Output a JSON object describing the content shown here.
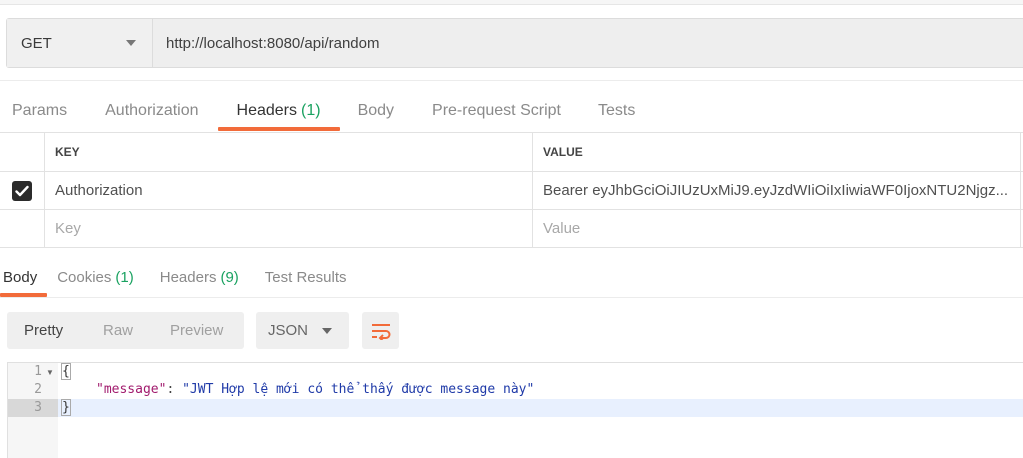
{
  "request": {
    "method": "GET",
    "url": "http://localhost:8080/api/random"
  },
  "request_tabs": [
    {
      "label": "Params",
      "count": ""
    },
    {
      "label": "Authorization",
      "count": ""
    },
    {
      "label": "Headers",
      "count": "(1)",
      "active": true
    },
    {
      "label": "Body",
      "count": ""
    },
    {
      "label": "Pre-request Script",
      "count": ""
    },
    {
      "label": "Tests",
      "count": ""
    }
  ],
  "headers_table": {
    "columns": [
      "KEY",
      "VALUE"
    ],
    "rows": [
      {
        "checked": true,
        "key": "Authorization",
        "value": "Bearer eyJhbGciOiJIUzUxMiJ9.eyJzdWIiOiIxIiwiaWF0IjoxNTU2Njgz..."
      }
    ],
    "placeholder": {
      "key": "Key",
      "value": "Value"
    }
  },
  "response_tabs": [
    {
      "label": "Body",
      "count": "",
      "active": true
    },
    {
      "label": "Cookies",
      "count": "(1)"
    },
    {
      "label": "Headers",
      "count": "(9)"
    },
    {
      "label": "Test Results",
      "count": ""
    }
  ],
  "toolbar": {
    "views": [
      "Pretty",
      "Raw",
      "Preview"
    ],
    "active_view": "Pretty",
    "format": "JSON",
    "wrap_icon": "text-wrap-icon"
  },
  "editor": {
    "line_numbers": [
      "1",
      "2",
      "3"
    ],
    "line1": "{",
    "line2_key": "\"message\"",
    "line2_colon": ": ",
    "line2_value": "\"JWT Hợp lệ mới có thể thấy được message này\"",
    "line3": "}"
  },
  "colors": {
    "accent": "#f26b3a",
    "count_green": "#1aa261",
    "json_key": "#a11a6d",
    "json_string": "#1f3aa8"
  }
}
